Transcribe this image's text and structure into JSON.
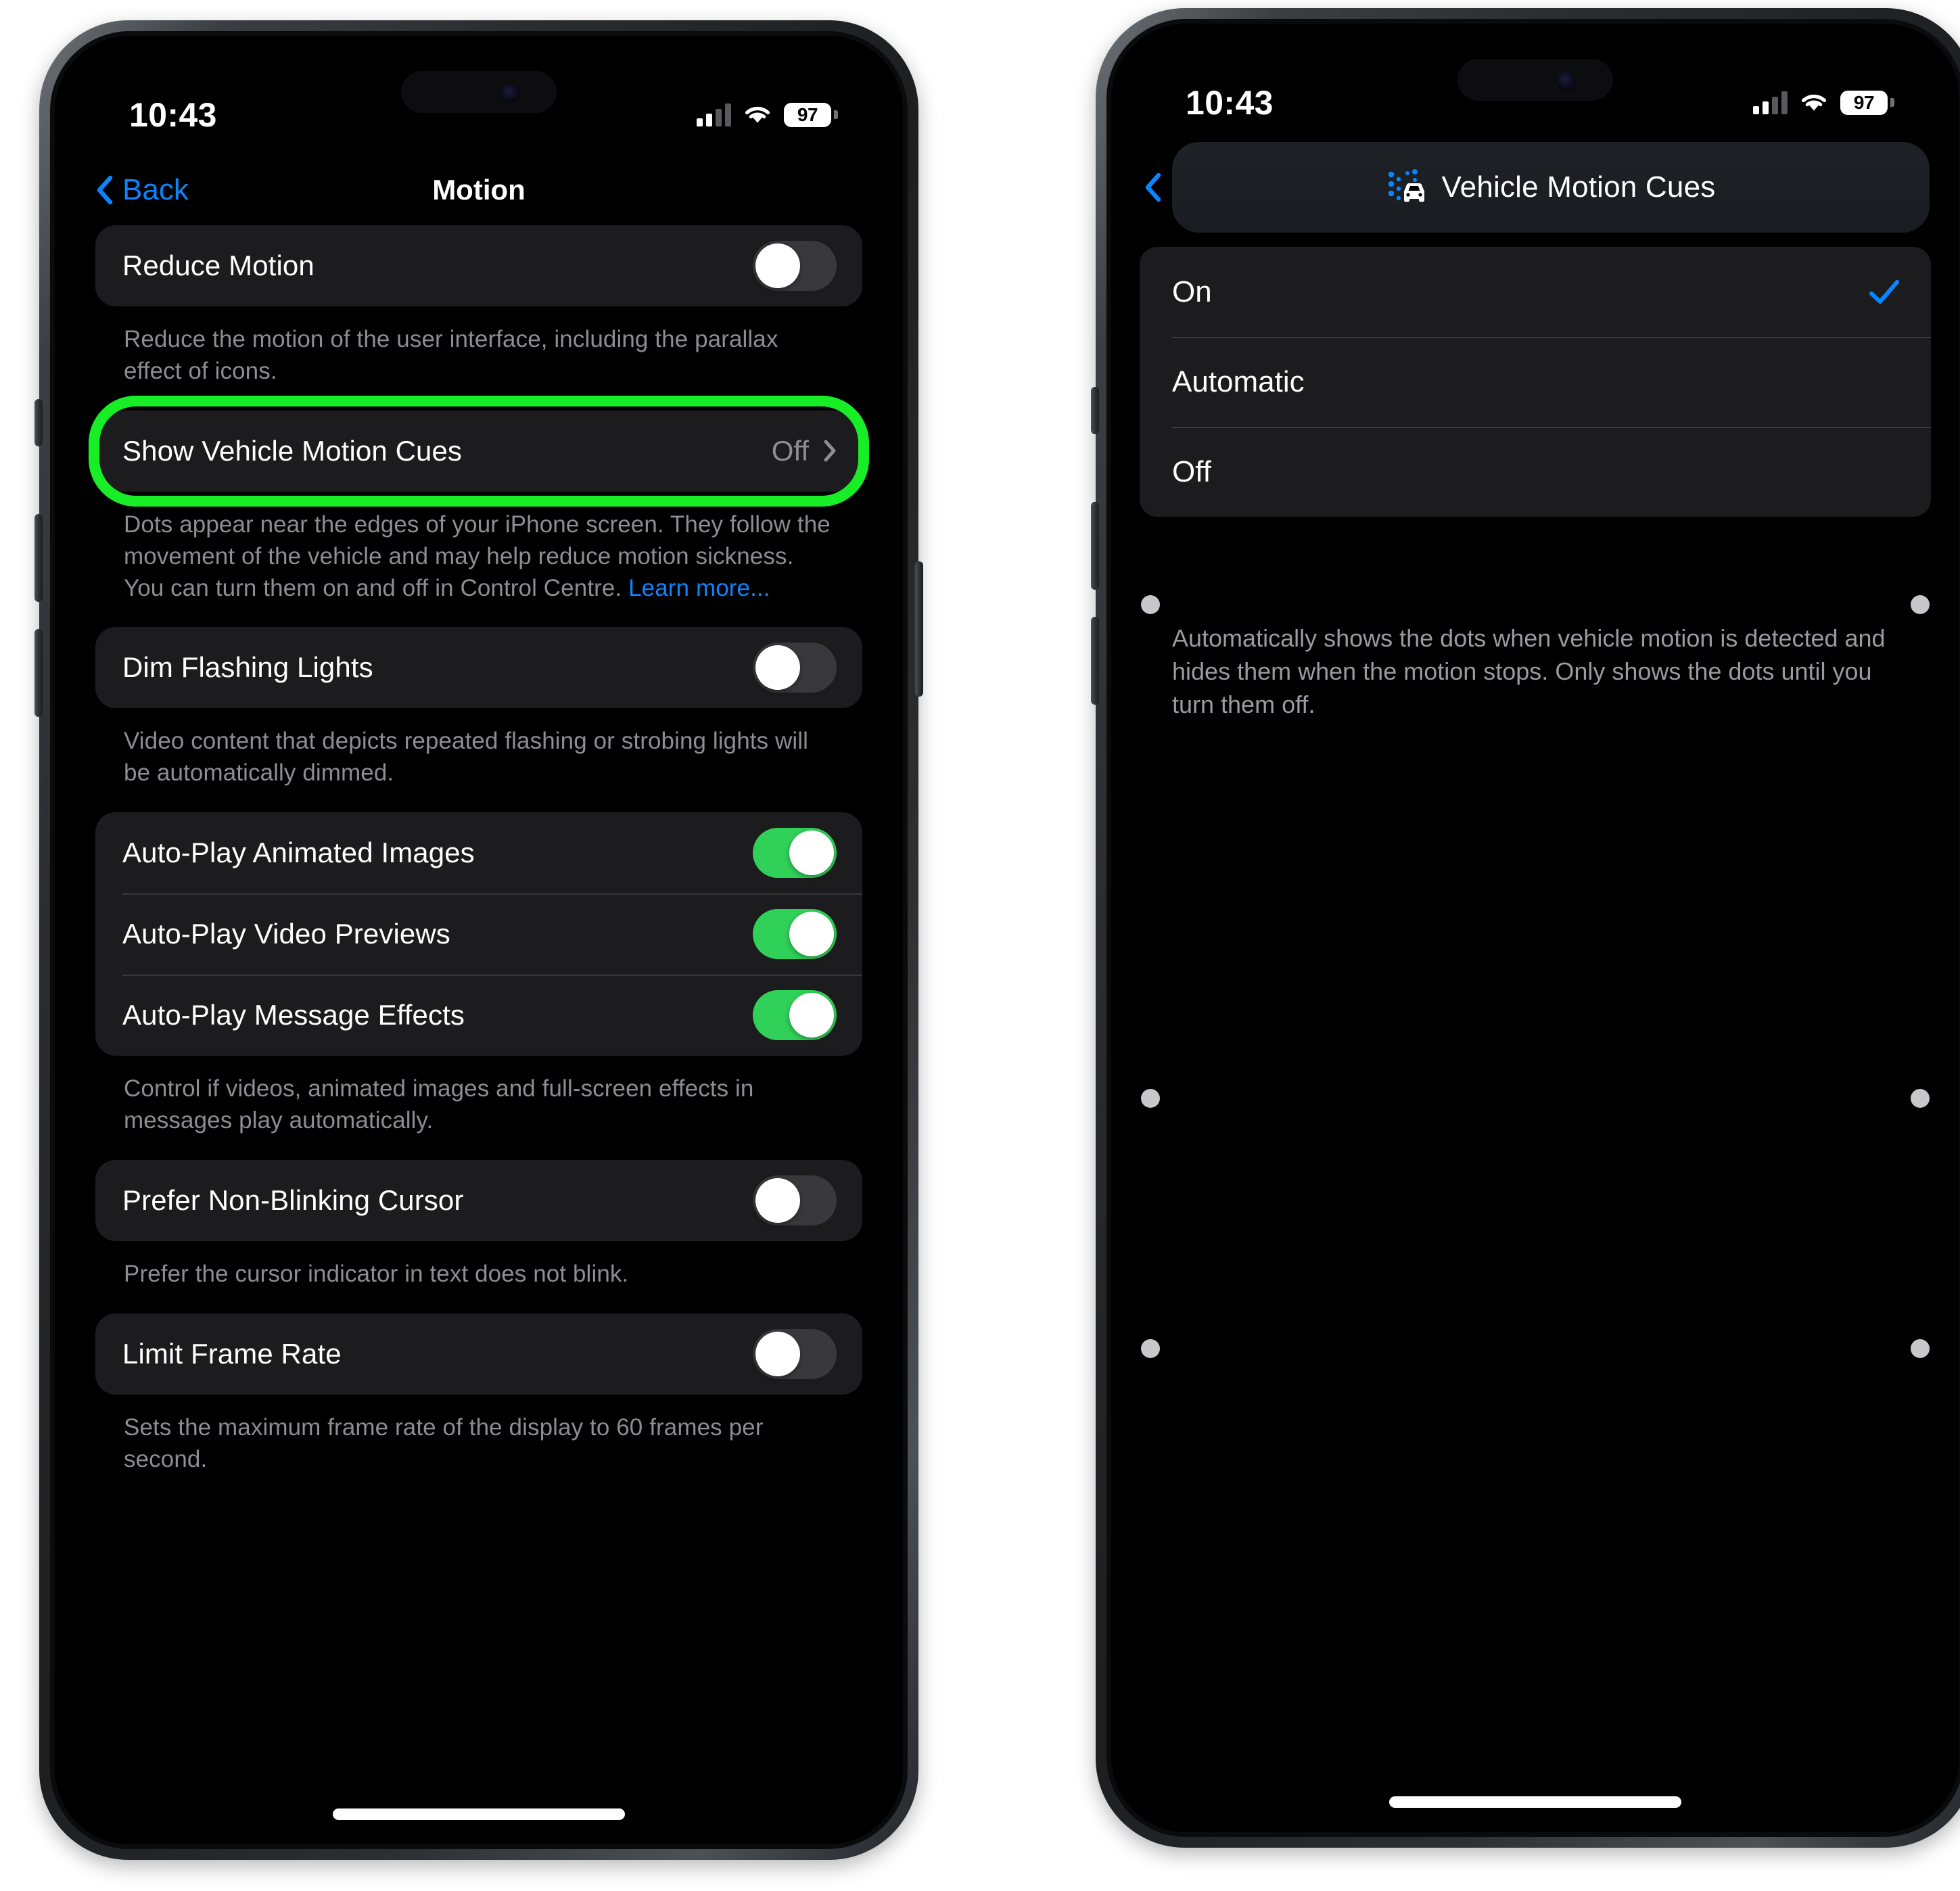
{
  "status_bar": {
    "time": "10:43",
    "cellular_icon": "cellular-signal-icon",
    "wifi_icon": "wifi-icon",
    "battery_level": "97",
    "battery_icon": "battery-icon"
  },
  "left_phone": {
    "nav": {
      "back_label": "Back",
      "back_icon": "chevron-left-icon",
      "title": "Motion"
    },
    "groups": [
      {
        "rows": [
          {
            "label": "Reduce Motion",
            "control": "toggle",
            "state": "off"
          }
        ],
        "footnote": "Reduce the motion of the user interface, including the parallax effect of icons."
      },
      {
        "highlighted": true,
        "rows": [
          {
            "label": "Show Vehicle Motion Cues",
            "control": "disclosure",
            "value": "Off",
            "chevron_icon": "chevron-right-icon"
          }
        ],
        "footnote": "Dots appear near the edges of your iPhone screen. They follow the movement of the vehicle and may help reduce motion sickness. You can turn them on and off in Control Centre. ",
        "footnote_link": "Learn more..."
      },
      {
        "rows": [
          {
            "label": "Dim Flashing Lights",
            "control": "toggle",
            "state": "off"
          }
        ],
        "footnote": "Video content that depicts repeated flashing or strobing lights will be automatically dimmed."
      },
      {
        "rows": [
          {
            "label": "Auto-Play Animated Images",
            "control": "toggle",
            "state": "on"
          },
          {
            "label": "Auto-Play Video Previews",
            "control": "toggle",
            "state": "on"
          },
          {
            "label": "Auto-Play Message Effects",
            "control": "toggle",
            "state": "on"
          }
        ],
        "footnote": "Control if videos, animated images and full-screen effects in messages play automatically."
      },
      {
        "rows": [
          {
            "label": "Prefer Non-Blinking Cursor",
            "control": "toggle",
            "state": "off"
          }
        ],
        "footnote": "Prefer the cursor indicator in text does not blink."
      },
      {
        "rows": [
          {
            "label": "Limit Frame Rate",
            "control": "toggle",
            "state": "off"
          }
        ],
        "footnote": "Sets the maximum frame rate of the display to 60 frames per second."
      }
    ]
  },
  "right_phone": {
    "nav": {
      "back_icon": "chevron-left-icon",
      "title": "Vehicle Motion Cues",
      "title_icon": "vehicle-motion-cues-icon"
    },
    "options": [
      {
        "label": "On",
        "selected": true,
        "check_icon": "checkmark-icon"
      },
      {
        "label": "Automatic",
        "selected": false
      },
      {
        "label": "Off",
        "selected": false
      }
    ],
    "footnote": "Automatically shows the dots when vehicle motion is detected and hides them when the motion stops. Only shows the dots until you turn them off.",
    "motion_cue_dots": 6
  },
  "colors": {
    "accent_blue": "#0a84ff",
    "toggle_green": "#30d158",
    "highlight_green": "#18ee26",
    "group_background": "#1c1c1e",
    "footnote_grey": "#8d8d92"
  }
}
